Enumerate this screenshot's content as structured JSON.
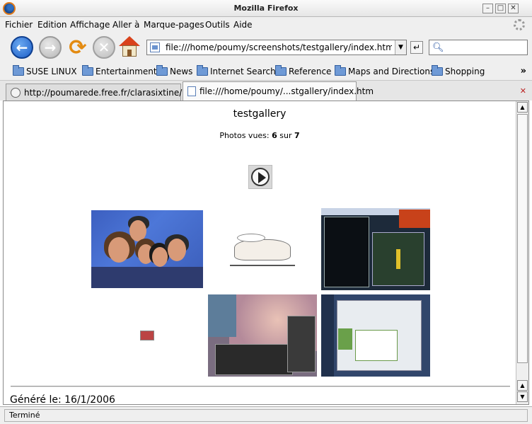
{
  "window": {
    "title": "Mozilla Firefox"
  },
  "menu": [
    "Fichier",
    "Edition",
    "Affichage",
    "Aller à",
    "Marque-pages",
    "Outils",
    "Aide"
  ],
  "toolbar": {
    "url": "file:///home/poumy/screenshots/testgallery/index.htm",
    "search_value": ""
  },
  "bookmarks": [
    "SUSE LINUX",
    "Entertainment",
    "News",
    "Internet Search",
    "Reference",
    "Maps and Directions",
    "Shopping"
  ],
  "tabs": [
    {
      "label": "http://poumarede.free.fr/clarasixtine/"
    },
    {
      "label": "file:///home/poumy/...stgallery/index.htm"
    }
  ],
  "gallery": {
    "title": "testgallery",
    "count_prefix": "Photos vues:",
    "count_seen": "6",
    "count_sep": "sur",
    "count_total": "7",
    "footer": "Généré le: 16/1/2006"
  },
  "status": {
    "text": "Terminé"
  },
  "colors": {
    "chrome": "#efefef",
    "accent": "#1c5ec8"
  }
}
